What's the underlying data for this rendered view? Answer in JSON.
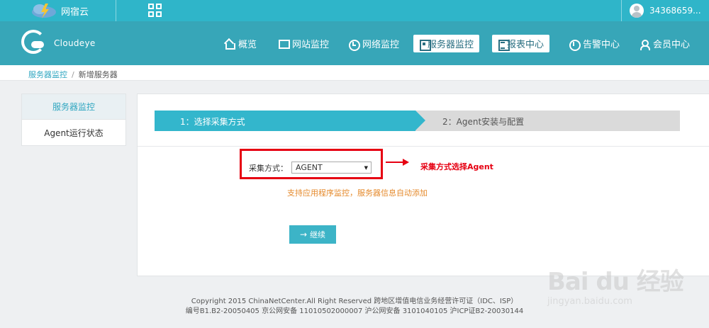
{
  "topbar": {
    "brand": "网宿云",
    "username": "34368659..."
  },
  "navbar": {
    "logo_text": "Cloudeye",
    "items": [
      {
        "label": "概览",
        "icon": "home-icon"
      },
      {
        "label": "网站监控",
        "icon": "monitor-icon"
      },
      {
        "label": "网络监控",
        "icon": "clock-icon"
      },
      {
        "label": "服务器监控",
        "icon": "server-icon",
        "active": true
      },
      {
        "label": "报表中心",
        "icon": "report-icon",
        "active": true
      },
      {
        "label": "告警中心",
        "icon": "alert-icon"
      },
      {
        "label": "会员中心",
        "icon": "user-icon"
      }
    ]
  },
  "breadcrumb": {
    "parent": "服务器监控",
    "separator": "/",
    "current": "新增服务器"
  },
  "sidebar": {
    "items": [
      {
        "label": "服务器监控",
        "active": true
      },
      {
        "label": "Agent运行状态",
        "active": false
      }
    ]
  },
  "wizard": {
    "step1": "1：选择采集方式",
    "step2": "2：Agent安装与配置"
  },
  "form": {
    "label": "采集方式：",
    "selected": "AGENT",
    "hint": "支持应用程序监控，服务器信息自动添加",
    "continue_label": "继续"
  },
  "annotation": {
    "text": "采集方式选择Agent"
  },
  "footer": {
    "line1": "Copyright 2015 ChinaNetCenter.All Right Reserved 跨地区增值电信业务经营许可证（IDC、ISP）",
    "line2": "编号B1.B2-20050405 京公网安备 11010502000007 沪公网安备 3101040105 沪ICP证B2-20030144"
  },
  "watermark": {
    "main": "Bai du 经验",
    "sub": "jingyan.baidu.com"
  },
  "colors": {
    "topbar": "#2fb5c9",
    "navbar": "#37a6b8",
    "accent": "#33b6cc",
    "annotation": "#e60012",
    "hint": "#e58a2c"
  }
}
